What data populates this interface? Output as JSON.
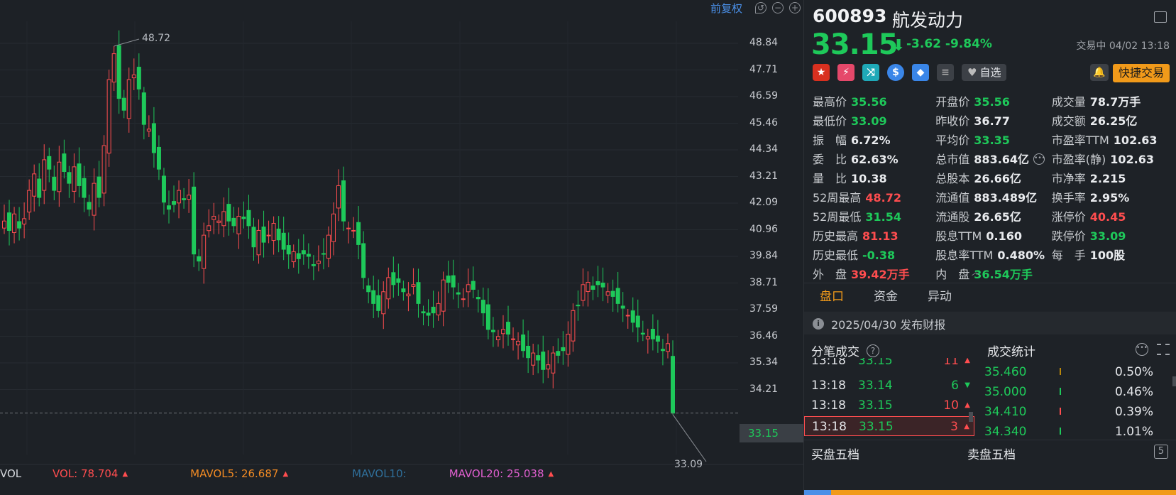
{
  "chart": {
    "restore_label": "前复权",
    "y_ticks": [
      "48.84",
      "47.71",
      "46.59",
      "45.46",
      "44.34",
      "43.21",
      "42.09",
      "40.96",
      "39.84",
      "38.71",
      "37.59",
      "36.46",
      "35.34",
      "34.21"
    ],
    "high_mark": "48.72",
    "low_mark": "33.09",
    "current_price_tag": "33.15"
  },
  "volume_bar": {
    "vol_prefix": "VOL",
    "vol": "VOL: 78.704",
    "mavol5": "MAVOL5: 26.687",
    "mavol10": "MAVOL10:",
    "mavol20": "MAVOL20: 25.038"
  },
  "stock": {
    "code": "600893",
    "name": "航发动力",
    "price": "33.15",
    "change": "-3.62",
    "change_pct": "-9.84%",
    "status": "交易中 04/02 13:18",
    "watch_label": "自选",
    "trade_label": "快捷交易"
  },
  "stats": [
    [
      {
        "label": "最高价",
        "value": "35.56",
        "color": "green"
      },
      {
        "label": "开盘价",
        "value": "35.56",
        "color": "green"
      },
      {
        "label": "成交量",
        "value": "78.7万手",
        "color": ""
      }
    ],
    [
      {
        "label": "最低价",
        "value": "33.09",
        "color": "green"
      },
      {
        "label": "昨收价",
        "value": "36.77",
        "color": ""
      },
      {
        "label": "成交额",
        "value": "26.25亿",
        "color": ""
      }
    ],
    [
      {
        "label": "振　幅",
        "value": "6.72%",
        "color": ""
      },
      {
        "label": "平均价",
        "value": "33.35",
        "color": "green"
      },
      {
        "label": "市盈率TTM",
        "value": "102.63",
        "color": ""
      }
    ],
    [
      {
        "label": "委　比",
        "value": "62.63%",
        "color": ""
      },
      {
        "label": "总市值",
        "value": "883.64亿",
        "color": ""
      },
      {
        "label": "市盈率(静)",
        "value": "102.63",
        "color": ""
      }
    ],
    [
      {
        "label": "量　比",
        "value": "10.38",
        "color": ""
      },
      {
        "label": "总股本",
        "value": "26.66亿",
        "color": ""
      },
      {
        "label": "市净率",
        "value": "2.215",
        "color": ""
      }
    ],
    [
      {
        "label": "52周最高",
        "value": "48.72",
        "color": "red"
      },
      {
        "label": "流通值",
        "value": "883.489亿",
        "color": ""
      },
      {
        "label": "换手率",
        "value": "2.95%",
        "color": ""
      }
    ],
    [
      {
        "label": "52周最低",
        "value": "31.54",
        "color": "green"
      },
      {
        "label": "流通股",
        "value": "26.65亿",
        "color": ""
      },
      {
        "label": "涨停价",
        "value": "40.45",
        "color": "red"
      }
    ],
    [
      {
        "label": "历史最高",
        "value": "81.13",
        "color": "red"
      },
      {
        "label": "股息TTM",
        "value": "0.160",
        "color": ""
      },
      {
        "label": "跌停价",
        "value": "33.09",
        "color": "green"
      }
    ],
    [
      {
        "label": "历史最低",
        "value": "-0.38",
        "color": "green"
      },
      {
        "label": "股息率TTM",
        "value": "0.480%",
        "color": ""
      },
      {
        "label": "每　手",
        "value": "100股",
        "color": ""
      }
    ],
    [
      {
        "label": "外　盘",
        "value": "39.42万手",
        "color": "red"
      },
      {
        "label": "内　盘",
        "value": "36.54万手",
        "color": "green"
      },
      {
        "label": "",
        "value": "",
        "color": ""
      }
    ]
  ],
  "tabs": [
    "盘口",
    "资金",
    "异动"
  ],
  "notice": "2025/04/30  发布财报",
  "ticks_title": "分笔成交",
  "ticks": [
    {
      "time": "13:18",
      "price": "33.15",
      "vol": "11",
      "dir": "up",
      "vcolor": "red"
    },
    {
      "time": "13:18",
      "price": "33.14",
      "vol": "6",
      "dir": "down",
      "vcolor": "green"
    },
    {
      "time": "13:18",
      "price": "33.15",
      "vol": "10",
      "dir": "up",
      "vcolor": "red"
    },
    {
      "time": "13:18",
      "price": "33.15",
      "vol": "3",
      "dir": "up",
      "vcolor": "red"
    }
  ],
  "vol_stats_title": "成交统计",
  "vol_stats": [
    {
      "price": "35.460",
      "pct": "0.50%",
      "bar": "#b8860b"
    },
    {
      "price": "35.000",
      "pct": "0.46%",
      "bar": "#1ec95a"
    },
    {
      "price": "34.410",
      "pct": "0.39%",
      "bar": "#ff4d4f"
    },
    {
      "price": "34.340",
      "pct": "1.01%",
      "bar": "#1ec95a"
    }
  ],
  "bottom_tabs": {
    "buy": "买盘五档",
    "sell": "卖盘五档",
    "five": "5"
  }
}
